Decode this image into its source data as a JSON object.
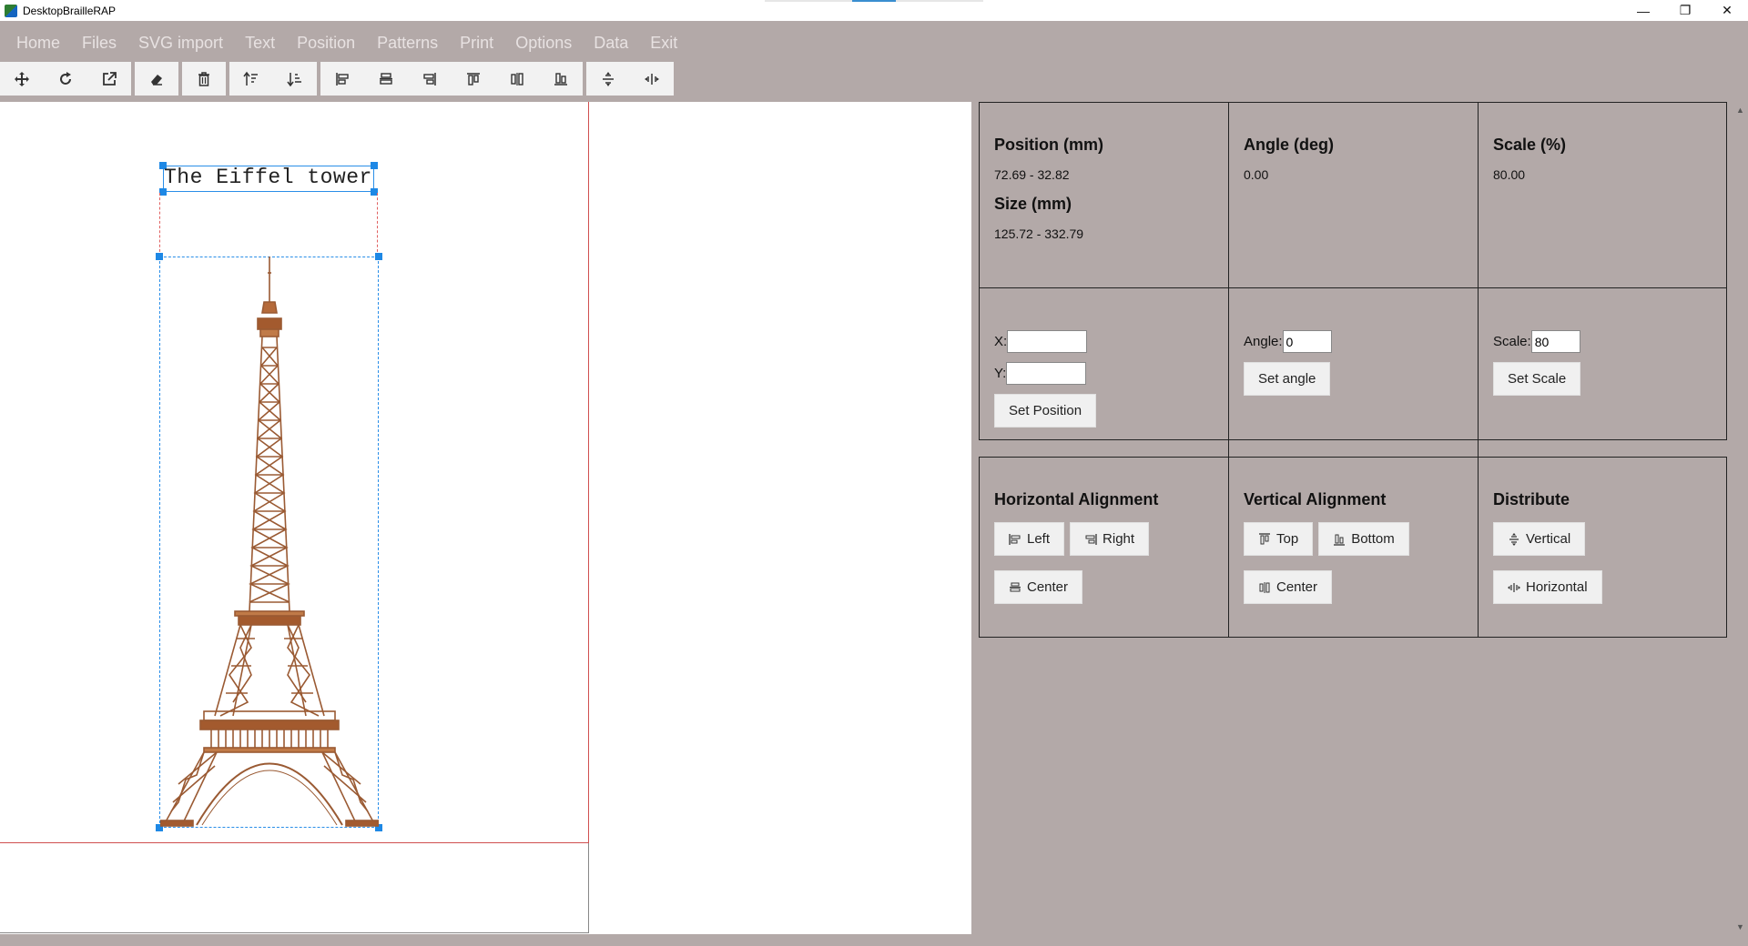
{
  "window": {
    "title": "DesktopBrailleRAP"
  },
  "menu": [
    "Home",
    "Files",
    "SVG import",
    "Text",
    "Position",
    "Patterns",
    "Print",
    "Options",
    "Data",
    "Exit"
  ],
  "canvas": {
    "caption": "The Eiffel tower"
  },
  "panel": {
    "position_label": "Position (mm)",
    "position_value": "72.69 - 32.82",
    "size_label": "Size (mm)",
    "size_value": "125.72 - 332.79",
    "angle_label": "Angle (deg)",
    "angle_value": "0.00",
    "scale_label": "Scale (%)",
    "scale_value": "80.00",
    "x_label": "X:",
    "x_value": "",
    "y_label": "Y:",
    "y_value": "",
    "set_position": "Set Position",
    "angle_input_label": "Angle:",
    "angle_input_value": "0",
    "set_angle": "Set angle",
    "scale_input_label": "Scale:",
    "scale_input_value": "80",
    "set_scale": "Set Scale",
    "h_align_label": "Horizontal Alignment",
    "h_left": "Left",
    "h_right": "Right",
    "h_center": "Center",
    "v_align_label": "Vertical Alignment",
    "v_top": "Top",
    "v_bottom": "Bottom",
    "v_center": "Center",
    "distribute_label": "Distribute",
    "d_vertical": "Vertical",
    "d_horizontal": "Horizontal"
  }
}
